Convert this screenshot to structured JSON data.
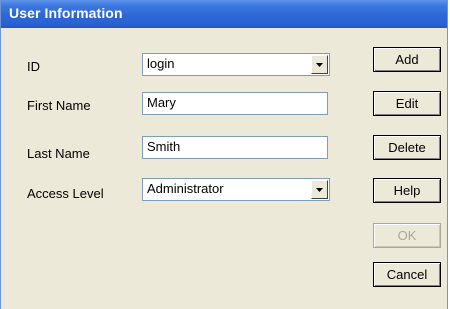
{
  "window": {
    "title": "User Information"
  },
  "form": {
    "id": {
      "label": "ID",
      "value": "login"
    },
    "first_name": {
      "label": "First Name",
      "value": "Mary"
    },
    "last_name": {
      "label": "Last Name",
      "value": "Smith"
    },
    "access_level": {
      "label": "Access Level",
      "value": "Administrator"
    }
  },
  "buttons": {
    "add": "Add",
    "edit": "Edit",
    "delete": "Delete",
    "help": "Help",
    "ok": "OK",
    "cancel": "Cancel"
  },
  "icons": {
    "dropdown": "chevron-down-icon"
  },
  "colors": {
    "titlebar": "#2d66d6",
    "dialog_bg": "#ece9d8",
    "disabled_text": "#aca899"
  }
}
